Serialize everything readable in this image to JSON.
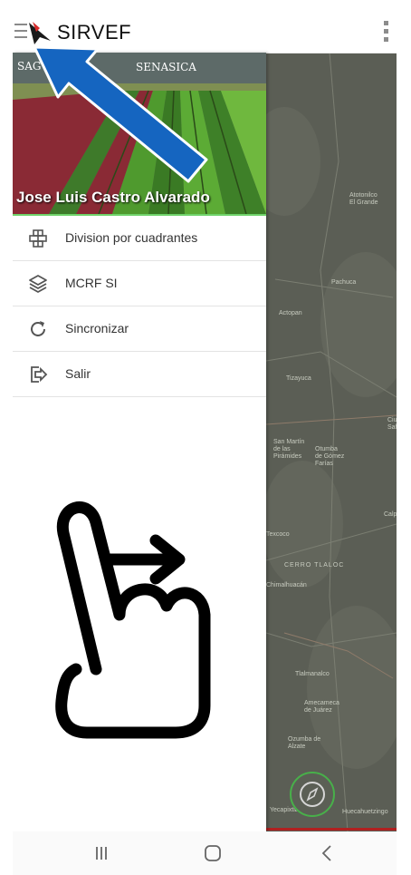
{
  "app_bar": {
    "title": "SIRVEF",
    "menu_icon": "hamburger-icon",
    "overflow_icon": "more-vert-icon"
  },
  "drawer": {
    "header": {
      "user_name": "Jose Luis Castro Alvarado",
      "logo_left": "SAG",
      "logo_right": "SENASICA"
    },
    "items": [
      {
        "label": "Division por cuadrantes",
        "icon": "grid-quadrants-icon"
      },
      {
        "label": "MCRF SI",
        "icon": "layers-icon"
      },
      {
        "label": "Sincronizar",
        "icon": "sync-icon"
      },
      {
        "label": "Salir",
        "icon": "logout-icon"
      }
    ]
  },
  "map": {
    "labels": [
      "Atotonilco\nEl Grande",
      "Pachuca",
      "Actopan",
      "Tizayuca",
      "Ciudad\nSahagún",
      "San Martín\nde las\nPirámides",
      "Otumba\nde Gómez\nFarías",
      "Calpulalpan",
      "CERRO TLALOC",
      "Chimalhuacán",
      "Texcoco",
      "Tlalmanalco",
      "Amecameca\nde Juárez",
      "Ozumba de\nAlzate",
      "Yecapixtla",
      "Huecahuetzingo"
    ]
  },
  "colors": {
    "map_bg": "#5b5e55",
    "accent_green": "#6fd36a",
    "arrow_blue": "#1565c0",
    "nav_red": "#b02020"
  },
  "nav_bar": {
    "recents_icon": "recents-icon",
    "home_icon": "home-icon",
    "back_icon": "back-icon"
  },
  "overlay": {
    "arrow": "pointer-arrow-icon",
    "gesture": "swipe-right-hand-icon"
  }
}
